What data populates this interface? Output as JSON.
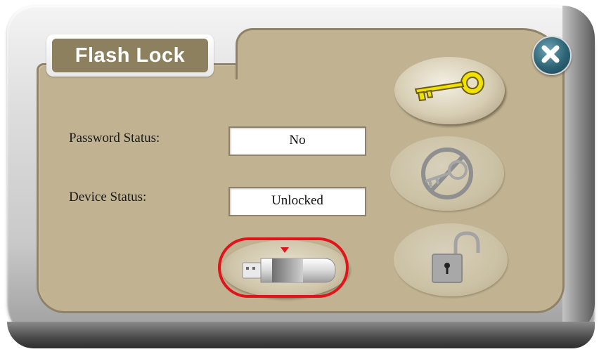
{
  "window": {
    "title": "Flash Lock"
  },
  "status": {
    "password_label": "Password Status:",
    "password_value": "No",
    "device_label": "Device Status:",
    "device_value": "Unlocked"
  },
  "buttons": {
    "close": {
      "icon": "close-icon"
    },
    "set_password": {
      "icon": "key-icon"
    },
    "remove_password": {
      "icon": "no-key-icon"
    },
    "unlock": {
      "icon": "unlock-padlock-icon"
    },
    "flash_drive": {
      "icon": "usb-drive-icon",
      "highlighted": true
    }
  },
  "colors": {
    "panel": "#c1b392",
    "title_background": "#8c805f",
    "highlight_ring": "#e0141b",
    "close_button": "#2c6476",
    "key_gold": "#f0e100"
  }
}
